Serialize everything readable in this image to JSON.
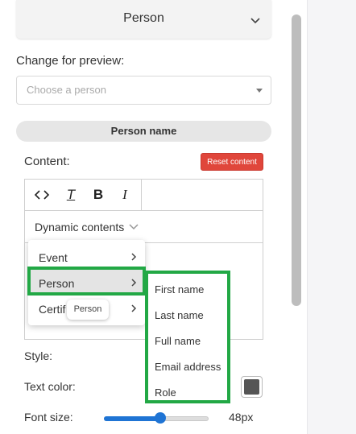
{
  "section": {
    "title": "Person"
  },
  "preview": {
    "label": "Change for preview:",
    "placeholder": "Choose a person"
  },
  "pill": {
    "label": "Person name"
  },
  "content": {
    "label": "Content:",
    "reset_label": "Reset content"
  },
  "toolbar": {
    "code": "<>",
    "clear_format": "T",
    "bold": "B",
    "italic": "I"
  },
  "dynamic": {
    "label": "Dynamic contents"
  },
  "menu": {
    "items": [
      {
        "label": "Event"
      },
      {
        "label": "Person"
      },
      {
        "label": "Certif"
      }
    ]
  },
  "tooltip": {
    "text": "Person"
  },
  "submenu": {
    "items": [
      {
        "label": "First name"
      },
      {
        "label": "Last name"
      },
      {
        "label": "Full name"
      },
      {
        "label": "Email address"
      },
      {
        "label": "Role"
      }
    ]
  },
  "style": {
    "label": "Style:"
  },
  "text_color": {
    "label": "Text color:",
    "value": "#555555"
  },
  "font_size": {
    "label": "Font size:",
    "value_text": "48px",
    "fraction": 0.54
  },
  "colors": {
    "accent_green": "#22a845",
    "reset_red": "#e0463b",
    "slider_blue": "#1f74d4"
  }
}
